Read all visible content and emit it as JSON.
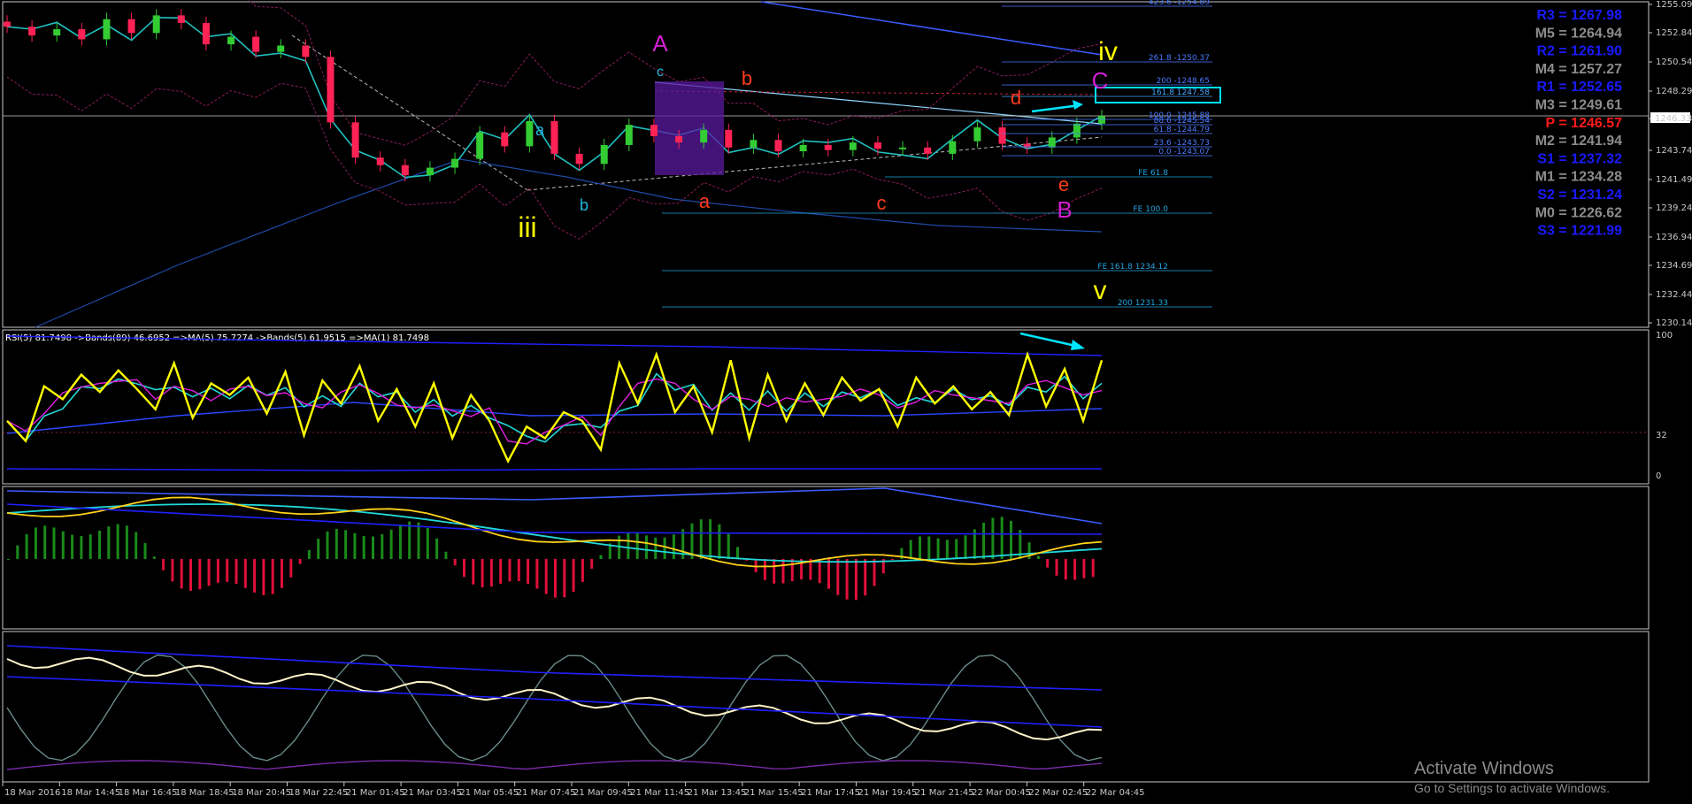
{
  "chart_data": {
    "type": "line",
    "title": "",
    "price_axis_ticks": [
      "1255.09",
      "1252.84",
      "1250.54",
      "1248.29",
      "1246.33",
      "1243.74",
      "1241.49",
      "1239.24",
      "1236.94",
      "1234.69",
      "1232.44",
      "1230.14"
    ],
    "current_price": "1246.33",
    "time_axis_ticks": [
      "18 Mar 2016",
      "18 Mar 14:45",
      "18 Mar 16:45",
      "18 Mar 18:45",
      "18 Mar 20:45",
      "18 Mar 22:45",
      "21 Mar 01:45",
      "21 Mar 03:45",
      "21 Mar 05:45",
      "21 Mar 07:45",
      "21 Mar 09:45",
      "21 Mar 11:45",
      "21 Mar 13:45",
      "21 Mar 15:45",
      "21 Mar 17:45",
      "21 Mar 19:45",
      "21 Mar 21:45",
      "22 Mar 00:45",
      "22 Mar 02:45",
      "22 Mar 04:45"
    ],
    "pivots": [
      {
        "label": "R3 = 1267.98",
        "color": "#1a1aff"
      },
      {
        "label": "M5 = 1264.94",
        "color": "#8c8c8c"
      },
      {
        "label": "R2 = 1261.90",
        "color": "#1a1aff"
      },
      {
        "label": "M4 = 1257.27",
        "color": "#8c8c8c"
      },
      {
        "label": "R1 = 1252.65",
        "color": "#1a1aff"
      },
      {
        "label": "M3 = 1249.61",
        "color": "#8c8c8c"
      },
      {
        "label": "P = 1246.57",
        "color": "#ff1a1a"
      },
      {
        "label": "M2 = 1241.94",
        "color": "#8c8c8c"
      },
      {
        "label": "S1 = 1237.32",
        "color": "#1a1aff"
      },
      {
        "label": "M1 = 1234.28",
        "color": "#8c8c8c"
      },
      {
        "label": "S2 = 1231.24",
        "color": "#1a1aff"
      },
      {
        "label": "M0 = 1226.62",
        "color": "#8c8c8c"
      },
      {
        "label": "S3 = 1221.99",
        "color": "#1a1aff"
      }
    ],
    "fib_levels": [
      {
        "label": "423.6 -1254.89",
        "color": "#4a7aff"
      },
      {
        "label": "261.8 -1250.37",
        "color": "#4a7aff"
      },
      {
        "label": "200 -1248.65",
        "color": "#4a7aff"
      },
      {
        "label": "161.8 1247.58",
        "color": "#4aa8ff"
      },
      {
        "label": "100.0 -1245.88",
        "color": "#4a7aff"
      },
      {
        "label": "88.6 -1245.54",
        "color": "#4a7aff"
      },
      {
        "label": "61.8 -1244.79",
        "color": "#4a7aff"
      },
      {
        "label": "23.6 -1243.73",
        "color": "#4a7aff"
      },
      {
        "label": "0.0 -1243.07",
        "color": "#4a7aff"
      },
      {
        "label": "FE 61.8",
        "color": "#21a5e0"
      },
      {
        "label": "FE 100.0",
        "color": "#21a5e0"
      },
      {
        "label": "FE 161.8 1234.12",
        "color": "#21a5e0"
      },
      {
        "label": "200 1231.33",
        "color": "#21a5e0"
      }
    ],
    "wave_labels": [
      {
        "text": "iii",
        "color": "#ffff00"
      },
      {
        "text": "A",
        "color": "#d11fd1"
      },
      {
        "text": "a",
        "color": "#1fb8e0"
      },
      {
        "text": "b",
        "color": "#1fb8e0"
      },
      {
        "text": "c",
        "color": "#1fb8e0"
      },
      {
        "text": "a",
        "color": "#ff3b1a"
      },
      {
        "text": "b",
        "color": "#ff3b1a"
      },
      {
        "text": "c",
        "color": "#ff3b1a"
      },
      {
        "text": "d",
        "color": "#ff3b1a"
      },
      {
        "text": "e",
        "color": "#ff3b1a"
      },
      {
        "text": "B",
        "color": "#d11fd1"
      },
      {
        "text": "C",
        "color": "#d11fd1"
      },
      {
        "text": "iv",
        "color": "#ffff00"
      },
      {
        "text": "v",
        "color": "#ffff00"
      }
    ],
    "rsi_title": "RSI(5) 81.7498  ->Bands(89) 46.6952  =>MA(5) 75.7274  ->Bands(5) 61.9515  =>MA(1) 81.7498",
    "rsi_ticks": [
      "100",
      "32",
      "0"
    ],
    "series": [
      {
        "name": "RSI(5)",
        "values": [
          40,
          26,
          64,
          55,
          72,
          60,
          75,
          62,
          48,
          80,
          42,
          66,
          58,
          70,
          45,
          74,
          30,
          68,
          52,
          78,
          40,
          62,
          36,
          66,
          28,
          58,
          40,
          12,
          36,
          28,
          46,
          40,
          20,
          80,
          52,
          86,
          46,
          64,
          32,
          82,
          28,
          72,
          40,
          66,
          44,
          70,
          54,
          62,
          36,
          70,
          52,
          64,
          48,
          60,
          44,
          86,
          50,
          76,
          40,
          82
        ]
      },
      {
        "name": "close",
        "values": [
          1253.6,
          1252.9,
          1253.4,
          1252.6,
          1254.2,
          1253.1,
          1254.5,
          1253.9,
          1252.2,
          1252.8,
          1251.6,
          1252.1,
          1251.2,
          1246.0,
          1243.2,
          1242.6,
          1241.8,
          1242.4,
          1243.1,
          1245.2,
          1244.1,
          1246.1,
          1243.5,
          1242.7,
          1244.2,
          1245.8,
          1244.9,
          1244.4,
          1245.4,
          1244.0,
          1244.6,
          1243.7,
          1244.2,
          1243.8,
          1244.4,
          1243.9,
          1244.0,
          1243.5,
          1244.5,
          1245.6,
          1244.3,
          1244.0,
          1244.8,
          1245.9,
          1246.5
        ]
      }
    ]
  },
  "watermark": {
    "line1": "Activate Windows",
    "line2": "Go to Settings to activate Windows."
  }
}
